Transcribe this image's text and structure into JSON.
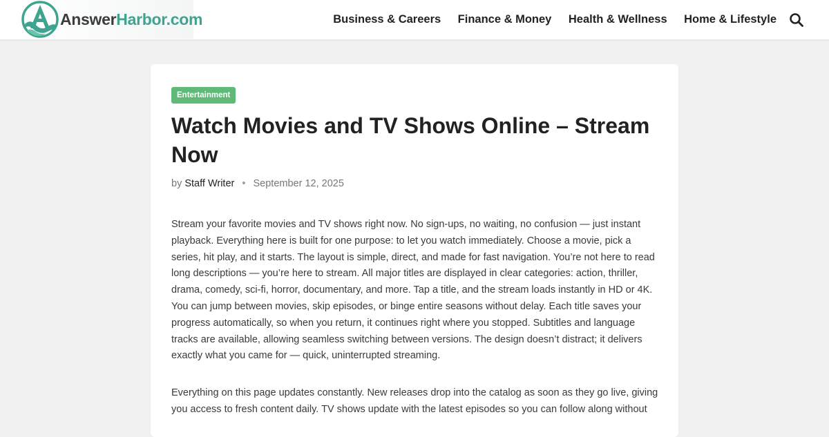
{
  "header": {
    "logo": {
      "name_part1": "Answer",
      "name_part2": "Harbor.com",
      "icon": "wave-letter-a-logo-icon"
    },
    "nav": [
      {
        "label": "Business & Careers"
      },
      {
        "label": "Finance & Money"
      },
      {
        "label": "Health & Wellness"
      },
      {
        "label": "Home & Lifestyle"
      }
    ],
    "search_icon": "search-icon"
  },
  "article": {
    "category": "Entertainment",
    "title": "Watch Movies and TV Shows Online – Stream Now",
    "meta": {
      "by": "by",
      "author": "Staff Writer",
      "separator": "•",
      "date": "September 12, 2025"
    },
    "paragraphs": [
      "Stream your favorite movies and TV shows right now. No sign-ups, no waiting, no confusion — just instant playback. Everything here is built for one purpose: to let you watch immediately. Choose a movie, pick a series, hit play, and it starts. The layout is simple, direct, and made for fast navigation. You’re not here to read long descriptions — you’re here to stream. All major titles are displayed in clear categories: action, thriller, drama, comedy, sci-fi, horror, documentary, and more. Tap a title, and the stream loads instantly in HD or 4K. You can jump between movies, skip episodes, or binge entire seasons without delay. Each title saves your progress automatically, so when you return, it continues right where you stopped. Subtitles and language tracks are available, allowing seamless switching between versions. The design doesn’t distract; it delivers exactly what you came for — quick, uninterrupted streaming.",
      "Everything on this page updates constantly. New releases drop into the catalog as soon as they go live, giving you access to fresh content daily. TV shows update with the latest episodes so you can follow along without"
    ]
  },
  "colors": {
    "brand_teal": "#3fa48f",
    "badge_green": "#5fba77",
    "page_bg": "#f1f1f1"
  }
}
